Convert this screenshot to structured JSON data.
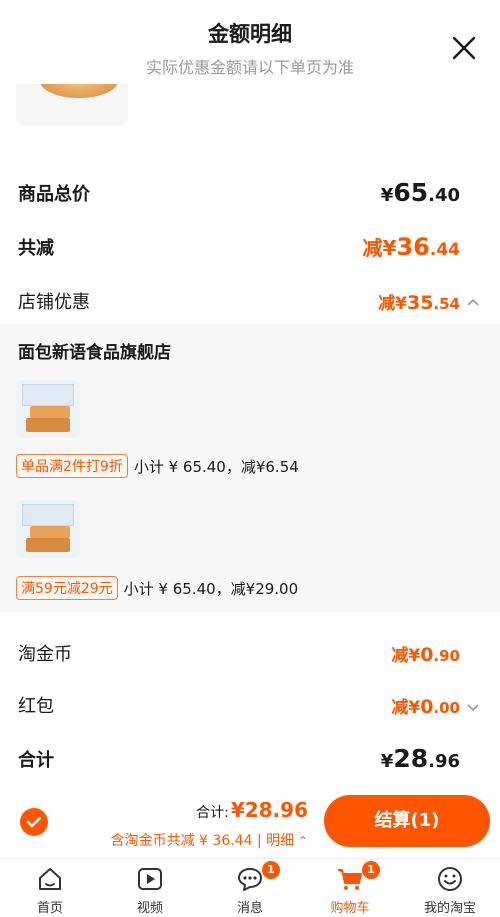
{
  "header": {
    "title": "金额明细",
    "subtitle": "实际优惠金额请以下单页为准"
  },
  "summary": {
    "goods_total_label": "商品总价",
    "goods_total_yen": "¥",
    "goods_total_int": "65",
    "goods_total_dec": ".40",
    "total_discount_label": "共减",
    "total_discount_prefix": "减¥",
    "total_discount_int": "36",
    "total_discount_dec": ".44",
    "store_discount_label": "店铺优惠",
    "store_discount_prefix": "减¥",
    "store_discount_int": "35",
    "store_discount_dec": ".54"
  },
  "store": {
    "name": "面包新语食品旗舰店",
    "items": [
      {
        "promo_tag": "单品满2件打9折",
        "subtotal_text": "小计 ¥ 65.40，减¥6.54"
      },
      {
        "promo_tag": "满59元减29元",
        "subtotal_text": "小计 ¥ 65.40，减¥29.00"
      }
    ]
  },
  "extras": {
    "coins_label": "淘金币",
    "coins_prefix": "减¥",
    "coins_int": "0",
    "coins_dec": ".90",
    "redpacket_label": "红包",
    "redpacket_prefix": "减¥",
    "redpacket_int": "0",
    "redpacket_dec": ".00",
    "total_label": "合计",
    "total_yen": "¥",
    "total_int": "28",
    "total_dec": ".96"
  },
  "bottom": {
    "total_label": "合计:",
    "total_value": "¥28.96",
    "savings_text": "含淘金币共减 ¥ 36.44",
    "separator": " | ",
    "detail_label": "明细",
    "checkout_label": "结算(1)"
  },
  "tabbar": {
    "tabs": [
      {
        "label": "首页",
        "icon": "home-icon"
      },
      {
        "label": "视频",
        "icon": "video-icon"
      },
      {
        "label": "消息",
        "icon": "message-icon",
        "badge": "1"
      },
      {
        "label": "购物车",
        "icon": "cart-icon",
        "badge": "1"
      },
      {
        "label": "我的淘宝",
        "icon": "profile-icon"
      }
    ]
  },
  "colors": {
    "accent": "#ff5500",
    "text": "#1a1a1a",
    "muted": "#9a9a9a"
  }
}
